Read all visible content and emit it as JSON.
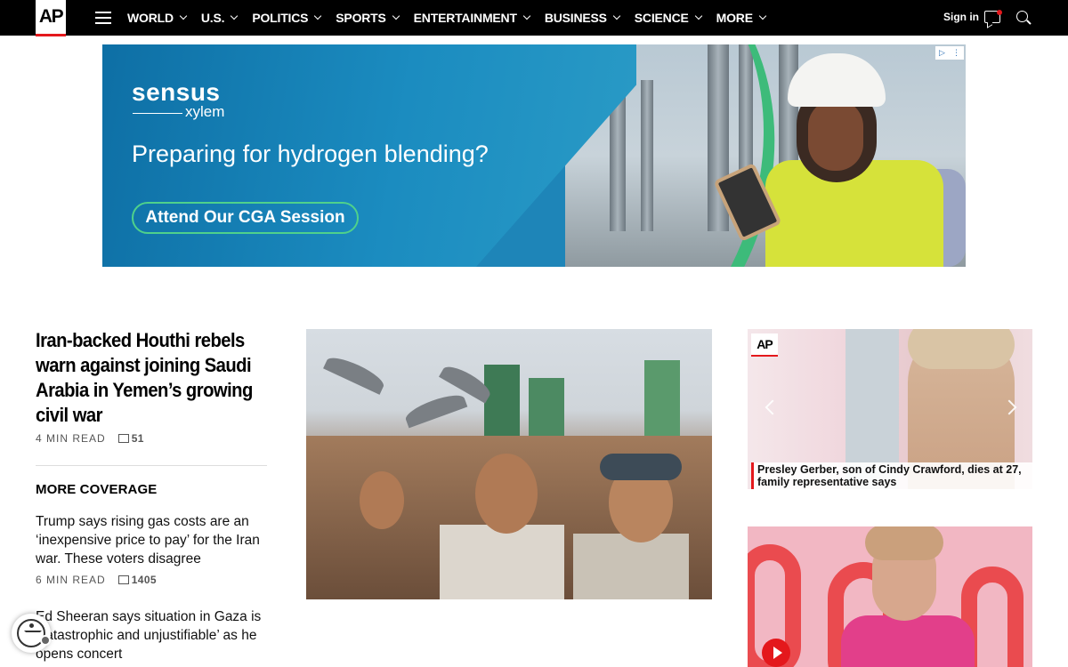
{
  "header": {
    "logo_text": "AP",
    "nav": [
      {
        "label": "WORLD"
      },
      {
        "label": "U.S."
      },
      {
        "label": "POLITICS"
      },
      {
        "label": "SPORTS"
      },
      {
        "label": "ENTERTAINMENT"
      },
      {
        "label": "BUSINESS"
      },
      {
        "label": "SCIENCE"
      },
      {
        "label": "MORE"
      }
    ],
    "signin_label": "Sign in",
    "icons": {
      "menu": "hamburger-menu-icon",
      "chat": "chat-bubble-icon",
      "search": "search-icon"
    }
  },
  "ad": {
    "brand_top": "sensus",
    "brand_bottom": "xylem",
    "headline": "Preparing for hydrogen blending?",
    "cta": "Attend Our CGA Session",
    "colors": {
      "bg": "#1a8dbf",
      "accent": "#4fd18b"
    }
  },
  "lead_story": {
    "headline": "Iran-backed Houthi rebels warn against joining Saudi Arabia in Yemen’s growing civil war",
    "read_time": "4 MIN READ",
    "comments": "51"
  },
  "more_coverage": {
    "heading": "MORE COVERAGE",
    "stories": [
      {
        "title": "Trump says rising gas costs are an ‘inexpensive price to pay’ for the Iran war. These voters disagree",
        "read_time": "6 MIN READ",
        "comments": "1405"
      },
      {
        "title": "Ed Sheeran says situation in Gaza is ‘catastrophic and unjustifiable’ as he opens concert"
      }
    ]
  },
  "promo": {
    "badge": "AP",
    "caption": "Presley Gerber, son of Cindy Crawford, dies at 27, family representative says"
  },
  "brand_colors": {
    "ap_red": "#e4181c",
    "nav_bg": "#000000"
  }
}
